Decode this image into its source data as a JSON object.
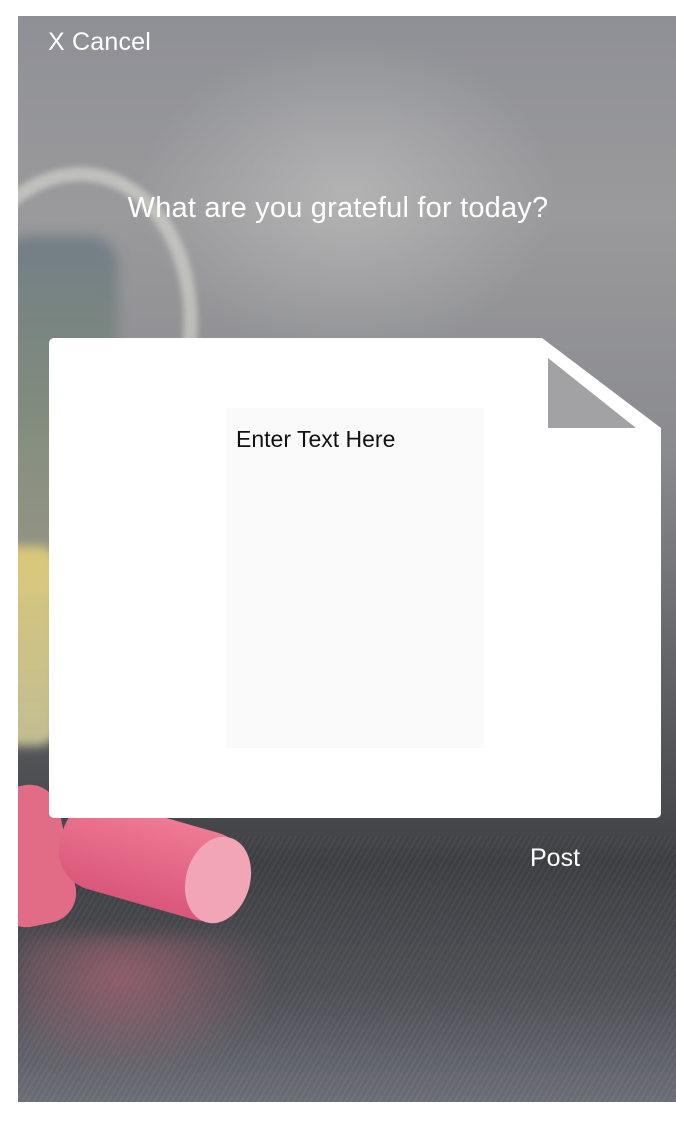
{
  "header": {
    "cancel_label": "X Cancel",
    "prompt": "What are you grateful for today?"
  },
  "note": {
    "text_area_placeholder": "Enter Text Here"
  },
  "footer": {
    "post_label": "Post"
  },
  "colors": {
    "note_background": "#ffffff",
    "text_area_background": "#fafafa",
    "fold_color": "#a2a2a4",
    "overlay_text": "#ffffff",
    "chalk_pink": "#e26b86"
  }
}
